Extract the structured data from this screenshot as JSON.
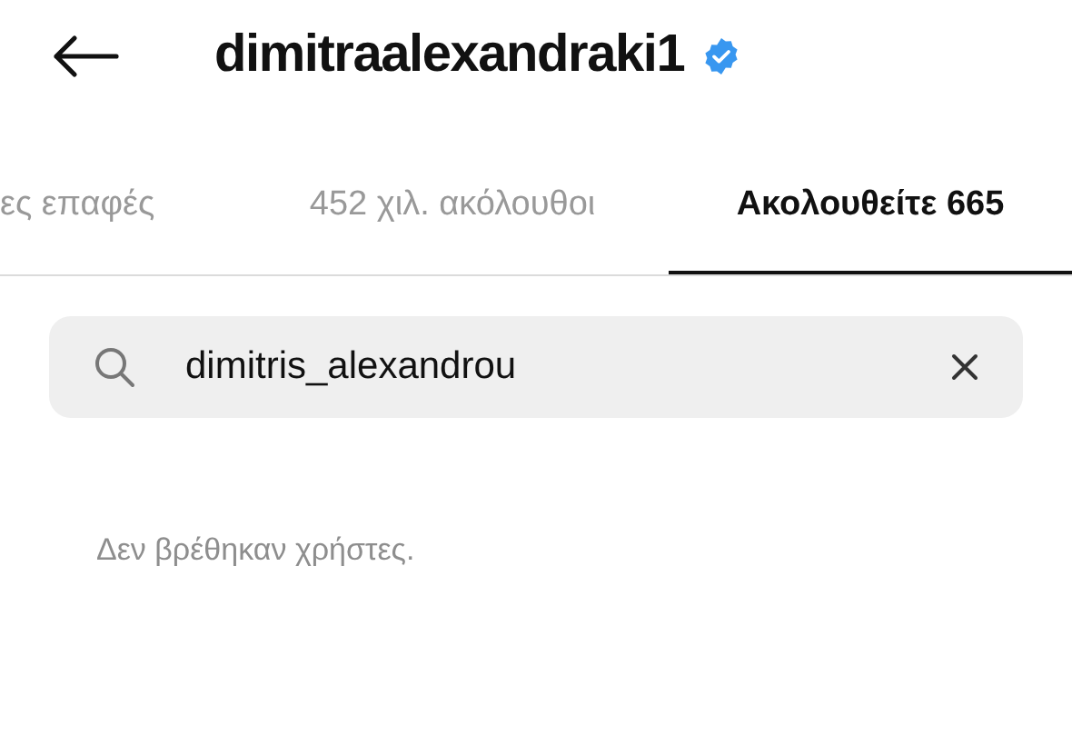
{
  "header": {
    "title": "dimitraalexandraki1",
    "verified": true
  },
  "tabs": [
    {
      "label": "ες επαφές",
      "selected": false
    },
    {
      "label": "452 χιλ. ακόλουθοι",
      "selected": false
    },
    {
      "label": "Ακολουθείτε 665",
      "selected": true
    }
  ],
  "search": {
    "value": "dimitris_alexandrou"
  },
  "empty_message": "Δεν βρέθηκαν χρήστες."
}
